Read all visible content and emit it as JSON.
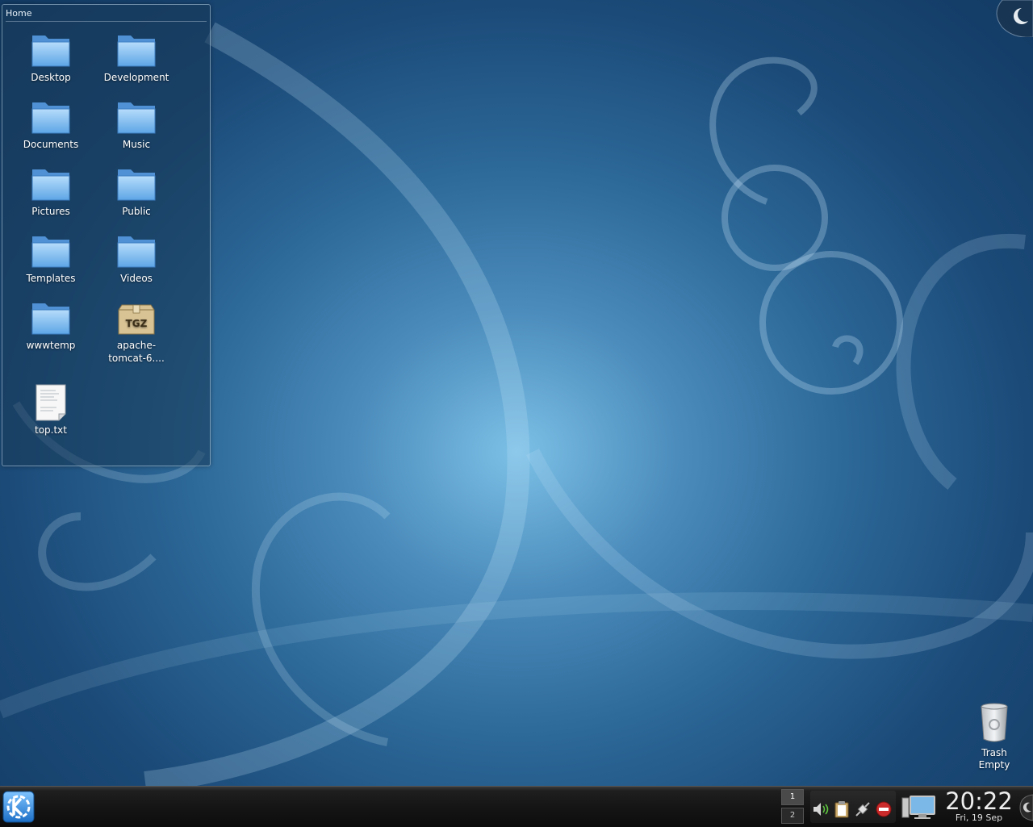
{
  "folderview": {
    "title": "Home",
    "items": [
      {
        "label": "Desktop",
        "icon": "folder-icon"
      },
      {
        "label": "Development",
        "icon": "folder-icon"
      },
      {
        "label": "Documents",
        "icon": "folder-icon"
      },
      {
        "label": "Music",
        "icon": "folder-icon"
      },
      {
        "label": "Pictures",
        "icon": "folder-icon"
      },
      {
        "label": "Public",
        "icon": "folder-icon"
      },
      {
        "label": "Templates",
        "icon": "folder-icon"
      },
      {
        "label": "Videos",
        "icon": "folder-icon"
      },
      {
        "label": "wwwtemp",
        "icon": "folder-icon"
      },
      {
        "label_line1": "apache-",
        "label_line2": "tomcat-6....",
        "icon": "tgz-archive-icon",
        "badge": "TGZ"
      },
      {
        "label": "top.txt",
        "icon": "text-file-icon"
      }
    ]
  },
  "trash": {
    "label": "Trash",
    "status": "Empty",
    "icon": "trash-icon"
  },
  "panel": {
    "kmenu_icon": "kde-logo-icon",
    "pager": {
      "desktops": [
        "1",
        "2"
      ],
      "active": "1"
    },
    "systray": [
      "volume-icon",
      "clipboard-icon",
      "network-plug-icon",
      "update-notifier-icon"
    ],
    "show_desktop_icon": "show-desktop-icon",
    "clock": {
      "time": "20:22",
      "date": "Fri, 19 Sep"
    }
  },
  "colors": {
    "wallpaper_light": "#7cc0e6",
    "wallpaper_dark": "#123a63",
    "folder_blue": "#8cc4f4",
    "panel_bg": "#151515"
  }
}
